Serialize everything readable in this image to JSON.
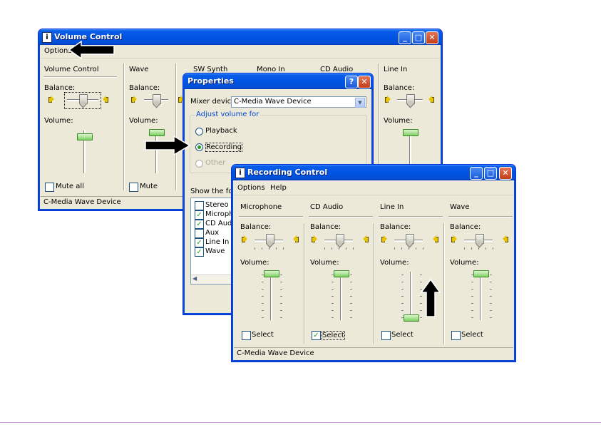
{
  "volume_control": {
    "title": "Volume Control",
    "menu": [
      "Options"
    ],
    "columns": [
      {
        "title": "Volume Control",
        "balance_label": "Balance:",
        "volume_label": "Volume:",
        "check_label": "Mute all",
        "checked": false
      },
      {
        "title": "Wave",
        "balance_label": "Balance:",
        "volume_label": "Volume:",
        "check_label": "Mute",
        "checked": false
      },
      {
        "title": "SW Synth"
      },
      {
        "title": "Mono In"
      },
      {
        "title": "CD Audio"
      },
      {
        "title": "Line In",
        "balance_label": "Balance:",
        "volume_label": "Volume:"
      }
    ],
    "status": "C-Media Wave Device"
  },
  "properties": {
    "title": "Properties",
    "mixer_label": "Mixer device:",
    "mixer_value": "C-Media Wave Device",
    "group_label": "Adjust volume for",
    "options": [
      {
        "label": "Playback",
        "selected": false,
        "enabled": true
      },
      {
        "label": "Recording",
        "selected": true,
        "enabled": true
      },
      {
        "label": "Other",
        "selected": false,
        "enabled": false
      }
    ],
    "show_label": "Show the follow",
    "list": [
      {
        "label": "Stereo Mi",
        "checked": false
      },
      {
        "label": "Microphor",
        "checked": true
      },
      {
        "label": "CD Audio",
        "checked": true
      },
      {
        "label": "Aux",
        "checked": false
      },
      {
        "label": "Line In",
        "checked": true
      },
      {
        "label": "Wave",
        "checked": true
      }
    ]
  },
  "recording_control": {
    "title": "Recording Control",
    "menu": [
      "Options",
      "Help"
    ],
    "columns": [
      {
        "title": "Microphone",
        "balance_label": "Balance:",
        "volume_label": "Volume:",
        "select_label": "Select",
        "selected": false,
        "volume_level": 1.0
      },
      {
        "title": "CD Audio",
        "balance_label": "Balance:",
        "volume_label": "Volume:",
        "select_label": "Select",
        "selected": true,
        "volume_level": 1.0
      },
      {
        "title": "Line In",
        "balance_label": "Balance:",
        "volume_label": "Volume:",
        "select_label": "Select",
        "selected": false,
        "volume_level": 0.0
      },
      {
        "title": "Wave",
        "balance_label": "Balance:",
        "volume_label": "Volume:",
        "select_label": "Select",
        "selected": false,
        "volume_level": 1.0
      }
    ],
    "status": "C-Media Wave Device"
  },
  "icons": {
    "window_icon": "mixer-icon",
    "speaker": "speaker-icon",
    "arrow": "pointer-arrow"
  },
  "colors": {
    "title_blue": "#0054e3",
    "close_red": "#c23e18",
    "face": "#ece9d8",
    "check_green": "#21a121"
  }
}
